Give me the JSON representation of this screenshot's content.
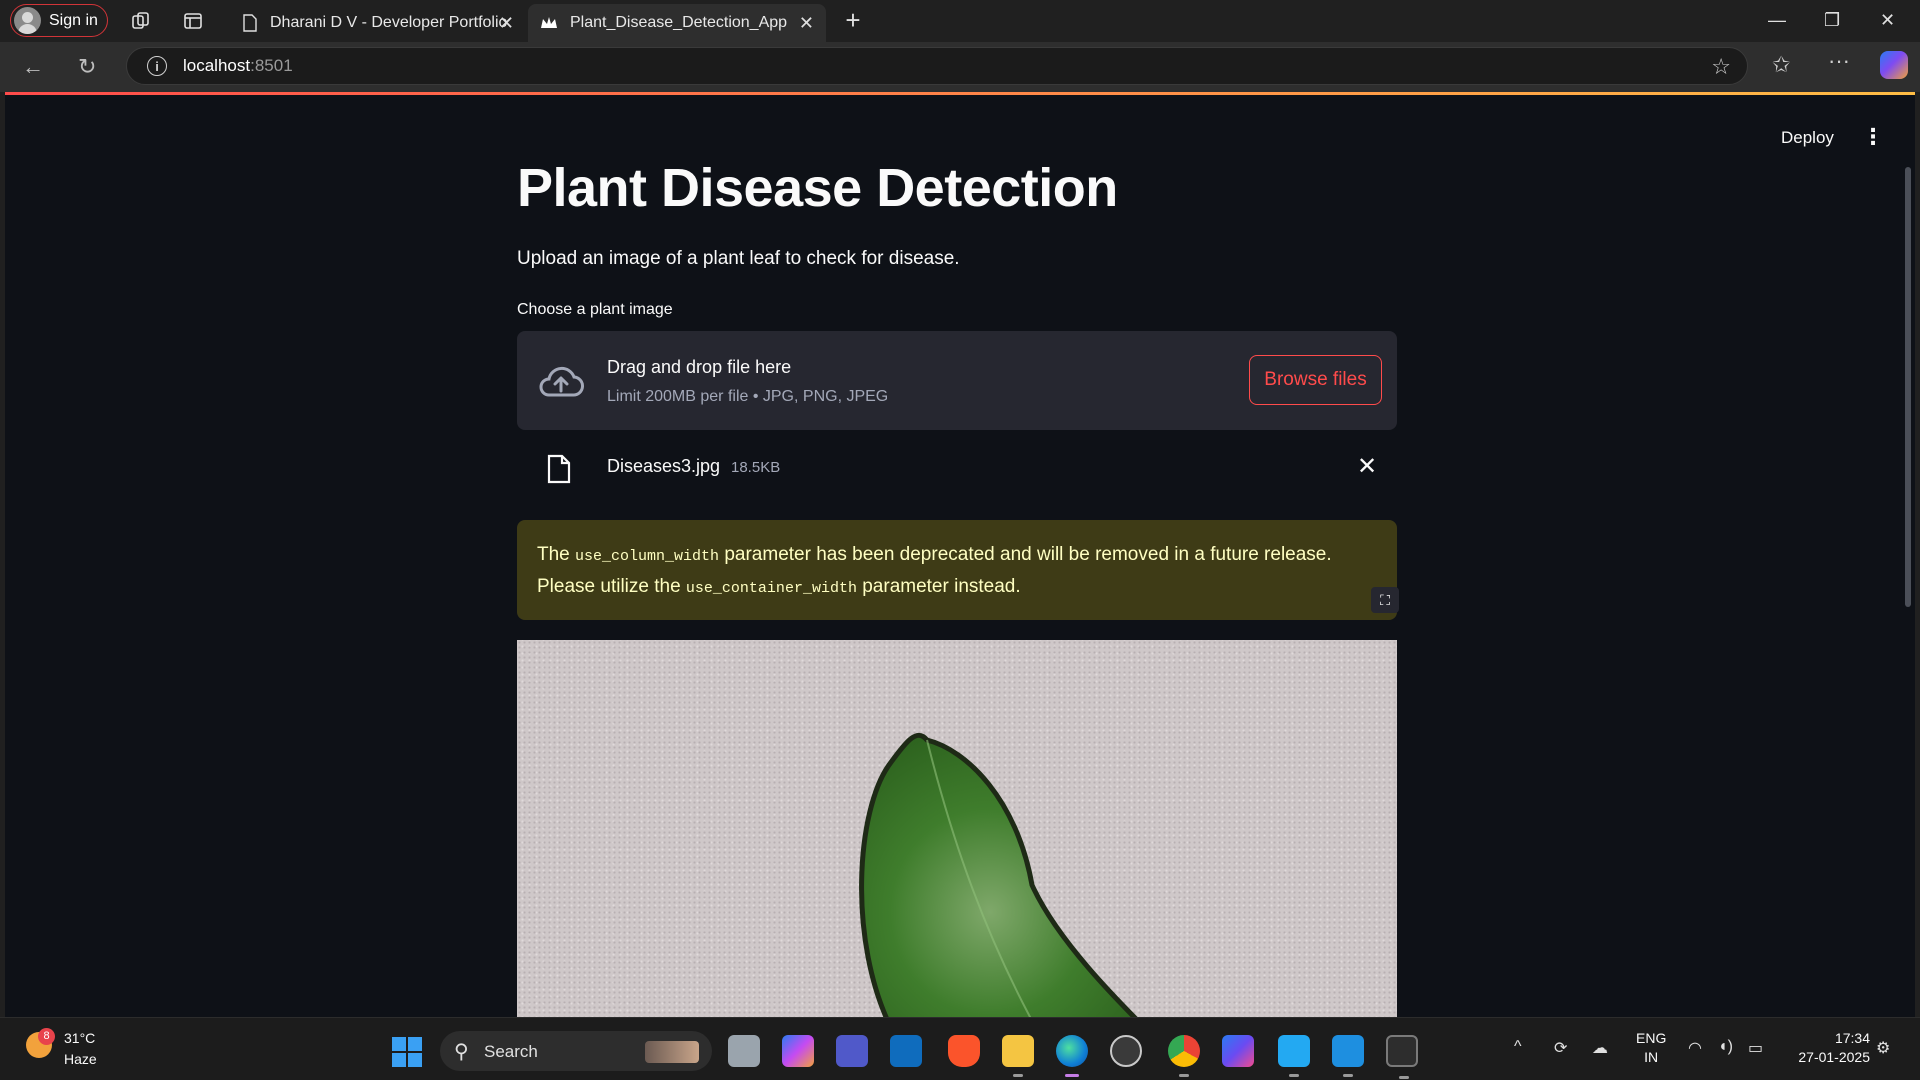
{
  "browser": {
    "signin_label": "Sign in",
    "tabs": [
      {
        "title": "Dharani D V - Developer Portfolio",
        "active": false
      },
      {
        "title": "Plant_Disease_Detection_App",
        "active": true
      }
    ],
    "address": {
      "host": "localhost",
      "port": ":8501"
    }
  },
  "app": {
    "header": {
      "deploy_label": "Deploy"
    },
    "title": "Plant Disease Detection",
    "subtitle": "Upload an image of a plant leaf to check for disease.",
    "uploader": {
      "label": "Choose a plant image",
      "drop_text": "Drag and drop file here",
      "limit_text": "Limit 200MB per file • JPG, PNG, JPEG",
      "browse_label": "Browse files"
    },
    "file": {
      "name": "Diseases3.jpg",
      "size": "18.5KB"
    },
    "warning": {
      "part1": "The ",
      "code1": "use_column_width",
      "part2": " parameter has been deprecated and will be removed in a future release. Please utilize the ",
      "code2": "use_container_width",
      "part3": " parameter instead."
    },
    "colors": {
      "background": "#0e1117",
      "accent": "#ff4b4b",
      "warning_bg": "#3e3b16",
      "warning_text": "#ffffc2"
    }
  },
  "taskbar": {
    "weather": {
      "badge": "8",
      "temp": "31°C",
      "desc": "Haze"
    },
    "search_label": "Search",
    "lang": {
      "line1": "ENG",
      "line2": "IN"
    },
    "clock": {
      "time": "17:34",
      "date": "27-01-2025"
    }
  }
}
